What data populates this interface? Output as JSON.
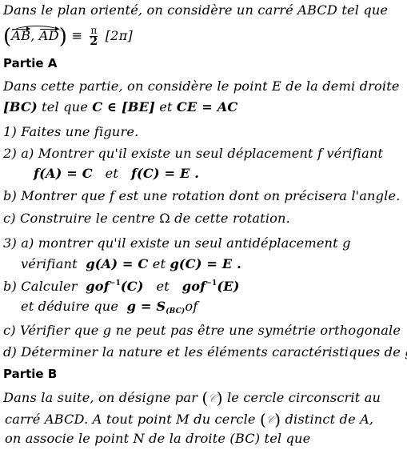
{
  "intro": {
    "line1": "Dans le plan orienté, on considère un carré ABCD tel que",
    "angle_vec1": "AB",
    "angle_vec2": "AD",
    "equiv": "≡",
    "frac_num": "π",
    "frac_den": "2",
    "modulo": "[2π]"
  },
  "partA": {
    "heading": "Partie A",
    "intro_line1": "Dans cette partie, on considère le point E de la demi droite",
    "intro_line2_seg": "[BC)",
    "intro_line2_text1": "tel que",
    "intro_line2_cond1": "C ∈ [BE]",
    "intro_line2_text2": "et",
    "intro_line2_cond2": "CE = AC",
    "q1": "1) Faites une figure.",
    "q2a_line1": "2) a) Montrer qu'il existe un seul déplacement f vérifiant",
    "q2a_f1": "f(A) = C",
    "q2a_et": "et",
    "q2a_f2": "f(C) = E .",
    "q2b": "b) Montrer que f est une rotation dont on précisera l'angle.",
    "q2c_text1": "c) Construire le centre",
    "q2c_omega": "Ω",
    "q2c_text2": "de cette rotation.",
    "q3a_line1": "3) a) montrer qu'il existe un seul antidéplacement g",
    "q3a_verif": "vérifiant",
    "q3a_g1": "g(A) = C",
    "q3a_et": "et",
    "q3a_g2": "g(C) = E .",
    "q3b_text": "b) Calculer",
    "q3b_expr1_base": "gof",
    "q3b_expr1_sup": "−1",
    "q3b_expr1_arg": "(C)",
    "q3b_et": "et",
    "q3b_expr2_base": "gof",
    "q3b_expr2_sup": "−1",
    "q3b_expr2_arg": "(E)",
    "q3b_line2_text": "et   déduire que",
    "q3b_line2_lhs": "g = S",
    "q3b_line2_sub": "(BC)",
    "q3b_line2_rhs": "of",
    "q3c": "c) Vérifier que g ne peut pas être une symétrie orthogonale",
    "q3d": "d) Déterminer la nature et les éléments caractéristiques de g."
  },
  "partB": {
    "heading": "Partie B",
    "line1_text1": "Dans la suite, on désigne par",
    "circle_symbol": "𝒞",
    "line1_text2": "le cercle circonscrit au",
    "line2_text1": "carré ABCD.  A tout point M du cercle",
    "line2_text2": "distinct de A,",
    "line3": "on associe le point N de la droite (BC) tel que"
  }
}
